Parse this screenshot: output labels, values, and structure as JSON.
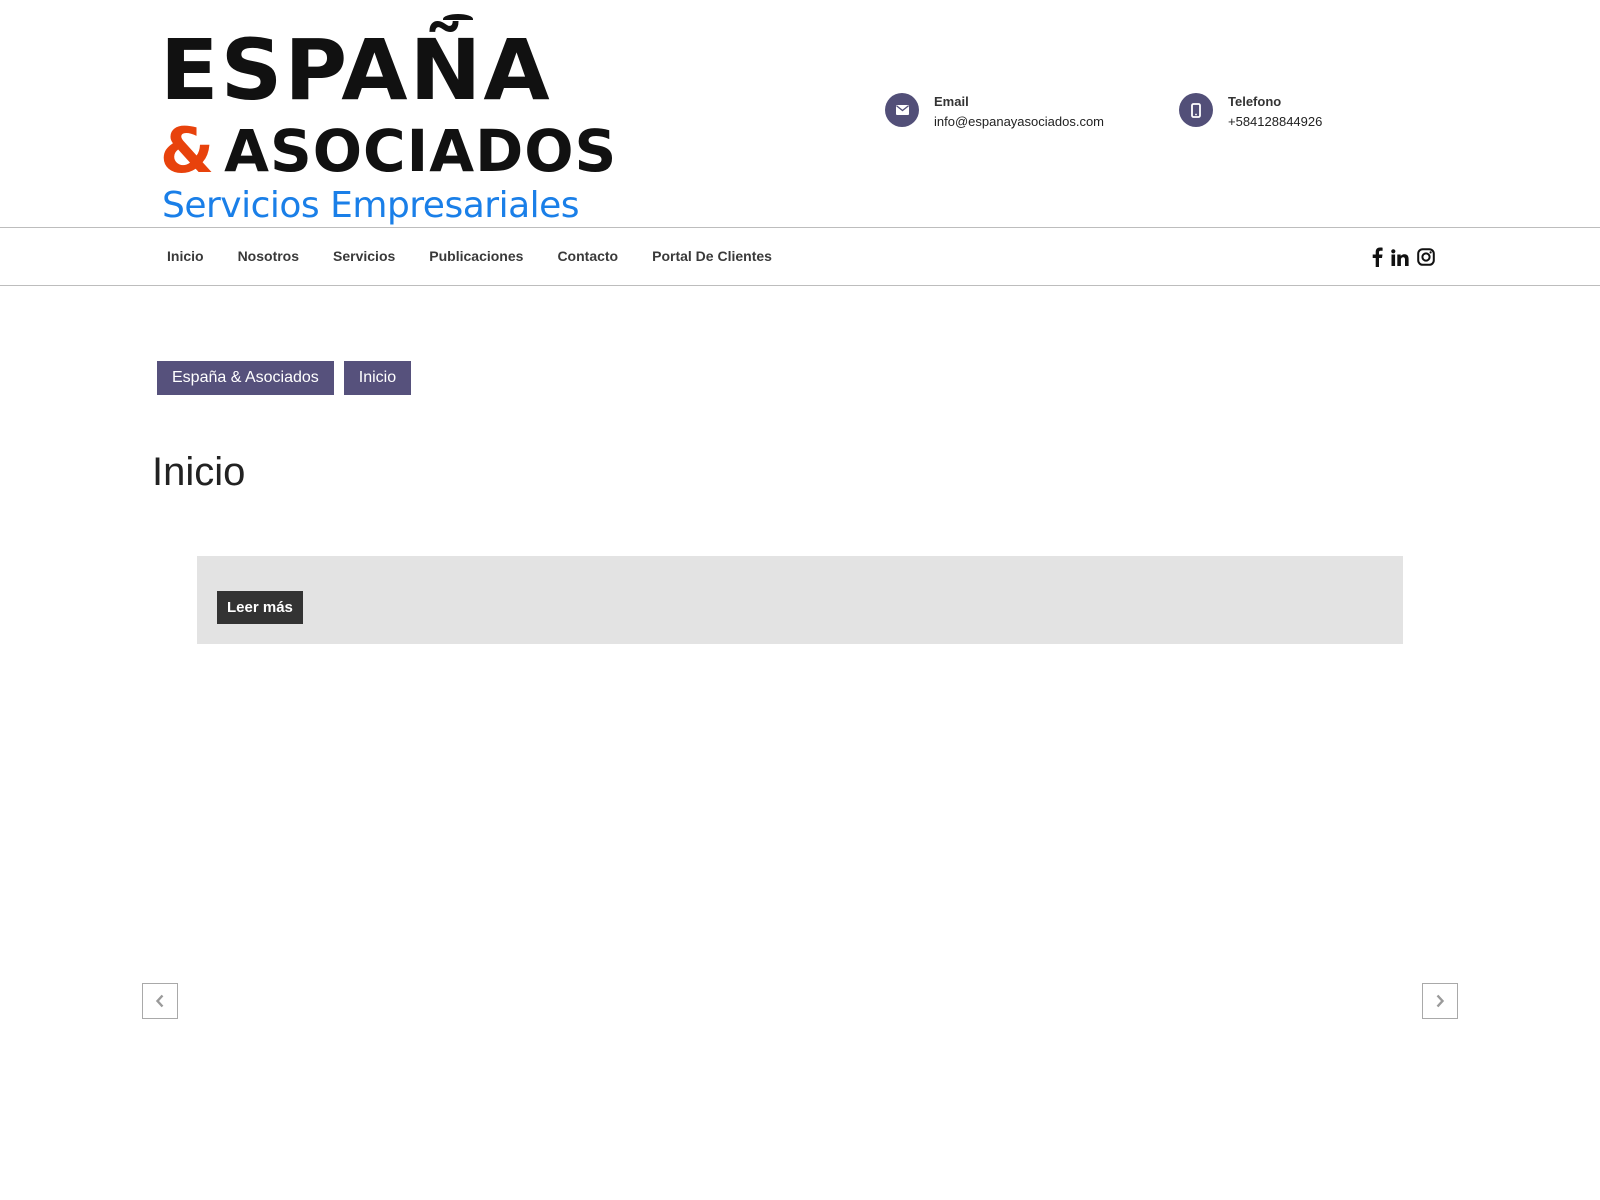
{
  "logo": {
    "line1": "ESPAÑA",
    "line2_amp": "&",
    "line2": "ASOCIADOS",
    "line3": "Servicios Empresariales"
  },
  "contact": {
    "email": {
      "label": "Email",
      "value": "info@espanayasociados.com",
      "icon": "envelope-icon"
    },
    "phone": {
      "label": "Telefono",
      "value": "+584128844926",
      "icon": "mobile-phone-icon"
    }
  },
  "nav": {
    "items": [
      {
        "label": "Inicio"
      },
      {
        "label": "Nosotros"
      },
      {
        "label": "Servicios"
      },
      {
        "label": "Publicaciones"
      },
      {
        "label": "Contacto"
      },
      {
        "label": "Portal De Clientes"
      }
    ],
    "social": [
      "facebook-icon",
      "linkedin-icon",
      "instagram-icon"
    ]
  },
  "breadcrumbs": [
    {
      "label": "España & Asociados"
    },
    {
      "label": "Inicio"
    }
  ],
  "page": {
    "title": "Inicio"
  },
  "slider": {
    "read_more": "Leer más",
    "prev_icon": "chevron-left-icon",
    "next_icon": "chevron-right-icon"
  },
  "colors": {
    "accent": "#524f78",
    "breadcrumb_bg": "#56517c",
    "logo_orange": "#e8420c",
    "logo_blue": "#1a7fe8",
    "slide_bg": "#e3e3e3",
    "button_bg": "#333333"
  }
}
